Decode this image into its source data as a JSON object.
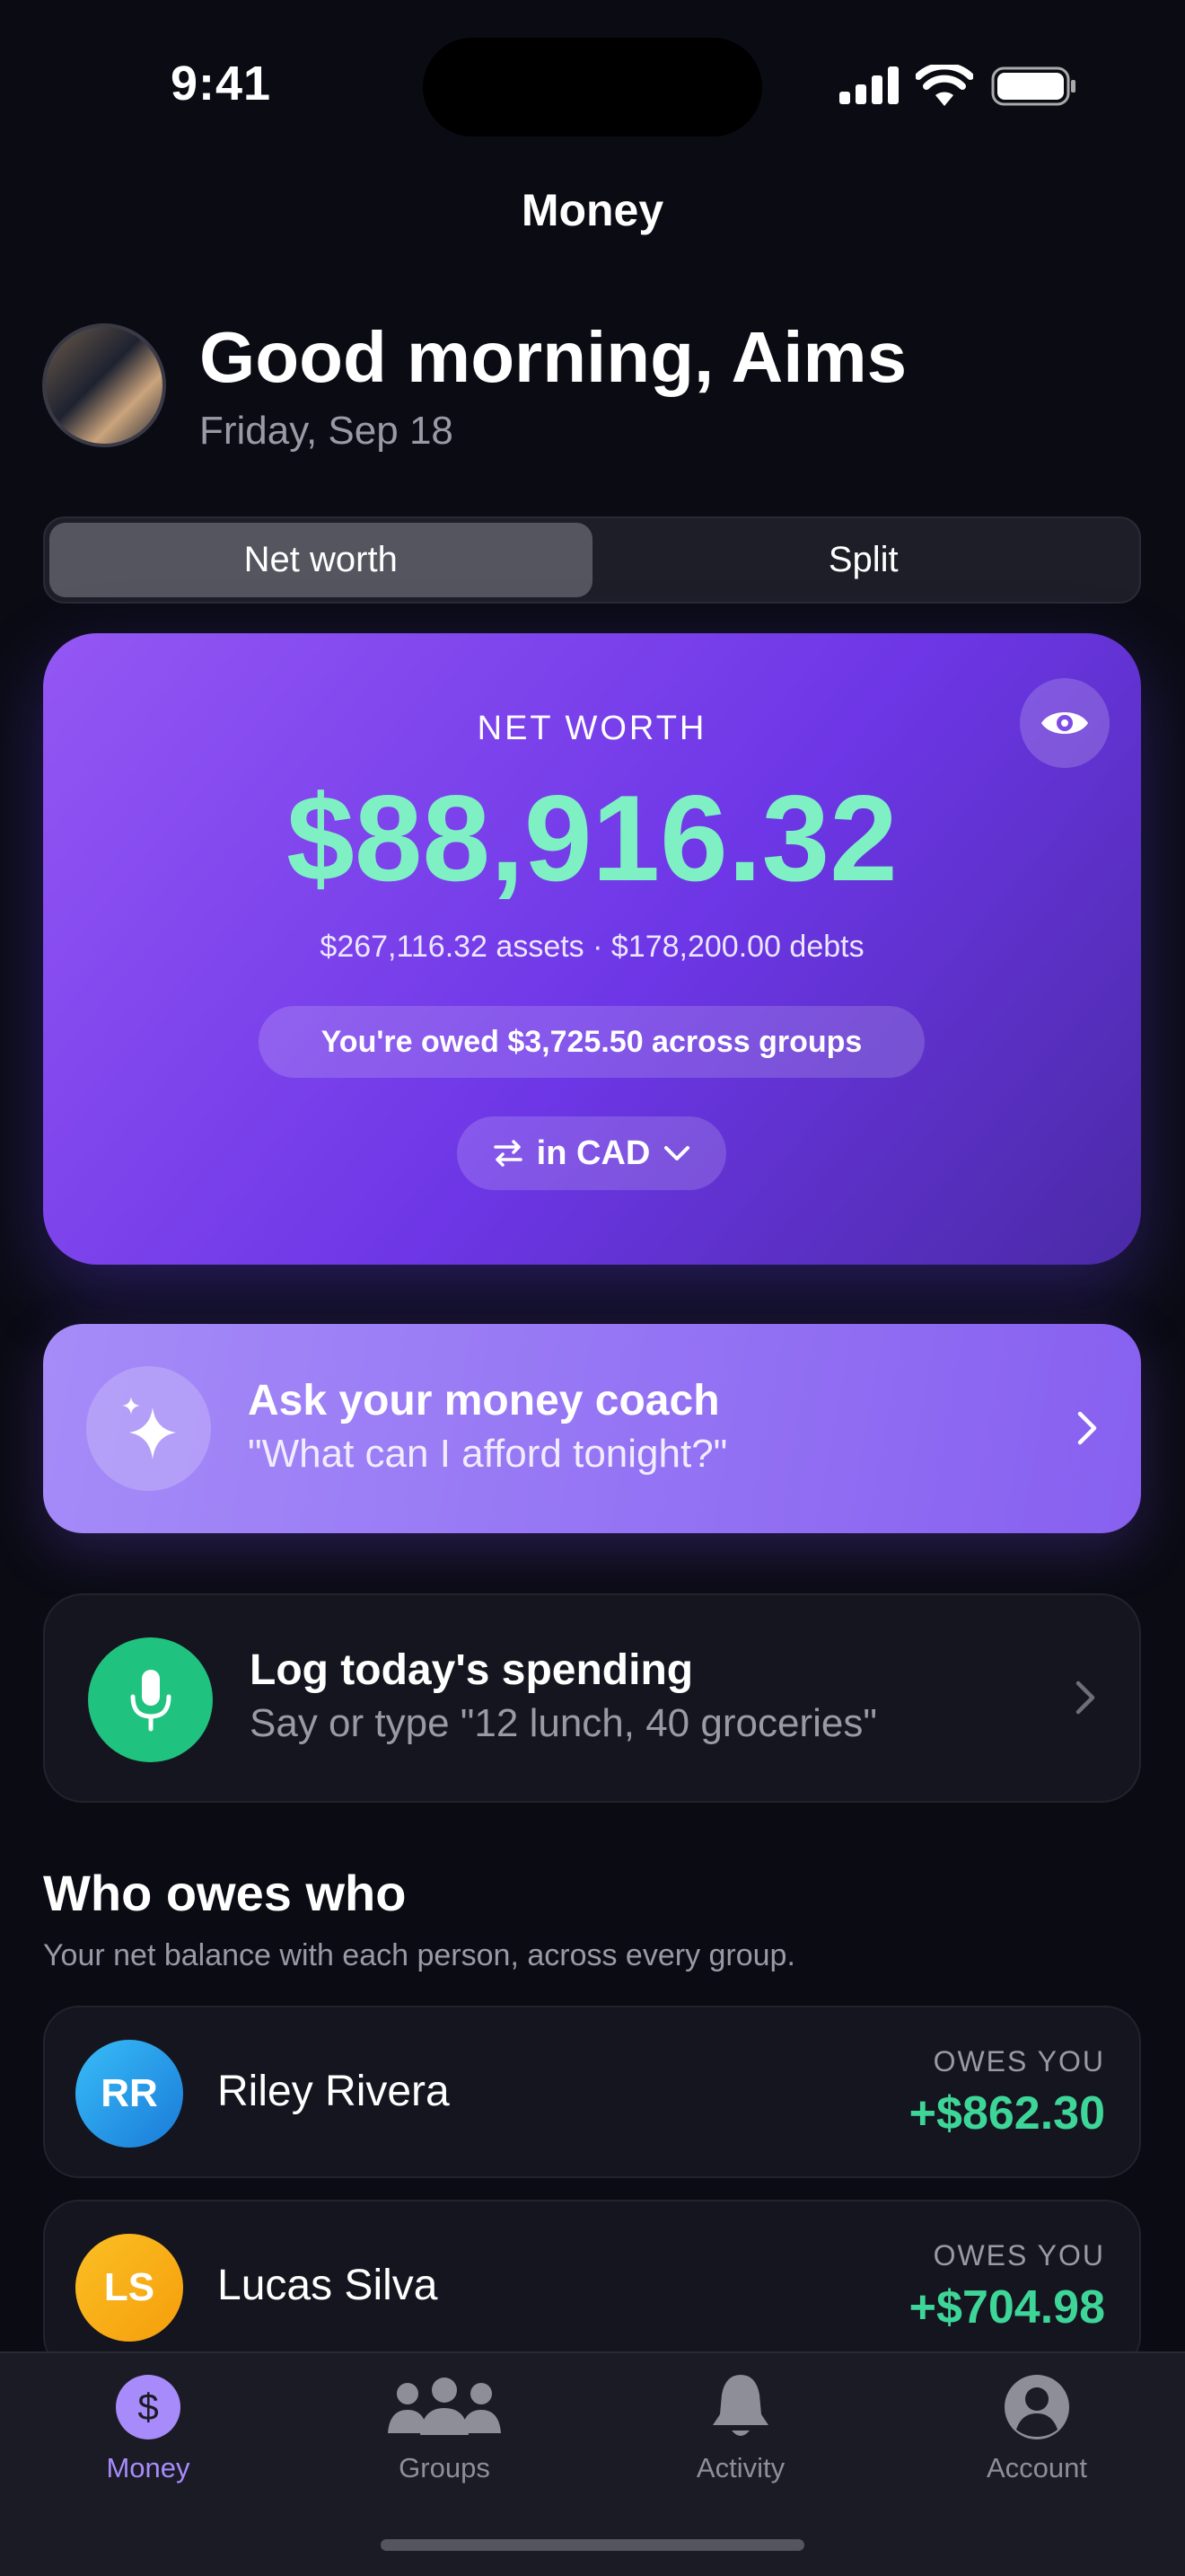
{
  "status_bar": {
    "time": "9:41"
  },
  "nav": {
    "title": "Money"
  },
  "header": {
    "greeting": "Good morning, Aims",
    "date": "Friday, Sep 18"
  },
  "segment": {
    "options": [
      "Net worth",
      "Split"
    ],
    "selected": "Net worth"
  },
  "net_worth": {
    "label": "NET WORTH",
    "amount": "$88,916.32",
    "breakdown": "$267,116.32 assets · $178,200.00 debts",
    "owed_summary": "You're owed $3,725.50 across groups",
    "currency_button": "in CAD"
  },
  "coach": {
    "title": "Ask your money coach",
    "subtitle": "\"What can I afford tonight?\""
  },
  "log_spending": {
    "title": "Log today's spending",
    "subtitle": "Say or type \"12 lunch, 40 groceries\""
  },
  "who_owes": {
    "title": "Who owes who",
    "subtitle": "Your net balance with each person, across every group.",
    "people": [
      {
        "initials": "RR",
        "name": "Riley Rivera",
        "status": "OWES YOU",
        "amount": "+$862.30"
      },
      {
        "initials": "LS",
        "name": "Lucas Silva",
        "status": "OWES YOU",
        "amount": "+$704.98"
      }
    ]
  },
  "tabs": [
    {
      "label": "Money",
      "icon": "dollar-icon"
    },
    {
      "label": "Groups",
      "icon": "people-icon"
    },
    {
      "label": "Activity",
      "icon": "bell-icon"
    },
    {
      "label": "Account",
      "icon": "person-icon"
    }
  ],
  "colors": {
    "accent": "#a78bfa",
    "positive": "#3ed598",
    "net_worth_amount": "#7ef0c4",
    "mic_green": "#1fc27e"
  }
}
